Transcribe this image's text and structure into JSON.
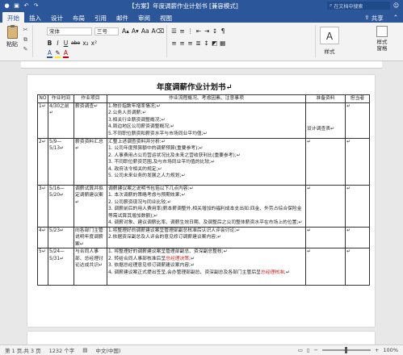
{
  "window": {
    "title": "【方案】年度调薪作业计划书 [兼容模式]",
    "search_placeholder": "在文档中搜索"
  },
  "ribbon_tabs": [
    "开始",
    "插入",
    "设计",
    "布局",
    "引用",
    "邮件",
    "审阅",
    "视图"
  ],
  "ribbon_right": {
    "share": "共享"
  },
  "ribbon": {
    "paste": "粘贴",
    "font_name": "宋体",
    "font_size": "三号",
    "styles": "样式",
    "styles_pane": "样式\n窗格",
    "format_row": [
      "B",
      "I",
      "U",
      "abe",
      "x₂",
      "x²"
    ],
    "font_row2": [
      "A",
      "A",
      "Aa",
      "A"
    ]
  },
  "document": {
    "title": "年度调薪作业计划书",
    "headers": [
      "NO",
      "作业时间",
      "作业项目",
      "作业流程概况、考虑因素、注意事项",
      "准备资料",
      "担当者"
    ],
    "rows": [
      {
        "no": "1",
        "time": "4/30之前",
        "item": "薪资调查",
        "details": [
          "1.物价指数年增率情况;",
          "2.公务人员调薪;",
          "3.相关行业薪资调整概况;",
          "4.周边地区公司薪资调整概况;",
          "5.不同职位薪资和薪资水平与市场同业平均值;"
        ],
        "materials": "设计调查表",
        "owner": ""
      },
      {
        "no": "2",
        "time": "5/9—5/13",
        "item": "薪资资料汇总",
        "details": [
          "汇整上述调查资料并分析:",
          "1. 公司年度预算额中的调薪预算(重要参考);",
          "2. 人事费用占公司营运状况比及未来之营收获利比(重要参考);",
          "3. 不同职位薪资范围,及与市场同业平均值的比较;",
          "4. 政府法令相关的规定;",
          "5. 公司未来业务的发展之人力规划;"
        ],
        "materials": "",
        "owner": ""
      },
      {
        "no": "3",
        "time": "5/16—5/20",
        "item": "调薪试算并拟定调薪建议案",
        "details": [
          "调薪建议案之说明书包括以下几点内容:",
          "1. 本次调薪的策略考虑与预期效果;",
          "2. 公司薪资现况与同业比较;",
          "3. 调薪前后的用人费用率(薪本薪调整外,相关增加的福利成本支出如:四金、外劳占综合保险金等需试算其增加数额);",
          "4. 调薪对象、建议调薪比率、调薪生效日期、及调整后之公司整体薪资水平在市场上的位置;"
        ],
        "materials": "",
        "owner": ""
      },
      {
        "no": "4",
        "time": "5/23",
        "item": "向各部门主管说明年度调薪案",
        "details": [
          "1.将整理好的调薪建议案呈管理部副总核准后认识人评会讨论;",
          "2.依据资深副总及人评会的意见修订调薪建议案内容;"
        ],
        "materials": "",
        "owner": ""
      },
      {
        "no": "5",
        "time": "5/24—5/31",
        "item": "与合同人事部、总经理讨论达成共识",
        "details": [
          "1. 将整理好的调薪建议案呈管理部副总、资深副总整核;",
          "2. 转给合同人事部核准后呈总经理决策;",
          "3. 依据总经理意见修订调薪建议案内容;",
          "4. 调薪建议案正式提出签呈,会办管理部副总、资深副总及各部门主管后呈总经理核准;"
        ],
        "red_phrases": [
          "总经理决策",
          "总经理核准"
        ],
        "materials": "",
        "owner": ""
      }
    ]
  },
  "status": {
    "page": "第 1 页,共 3 页",
    "words": "1232 个字",
    "lang": "中文(中国)",
    "zoom": "100%"
  }
}
